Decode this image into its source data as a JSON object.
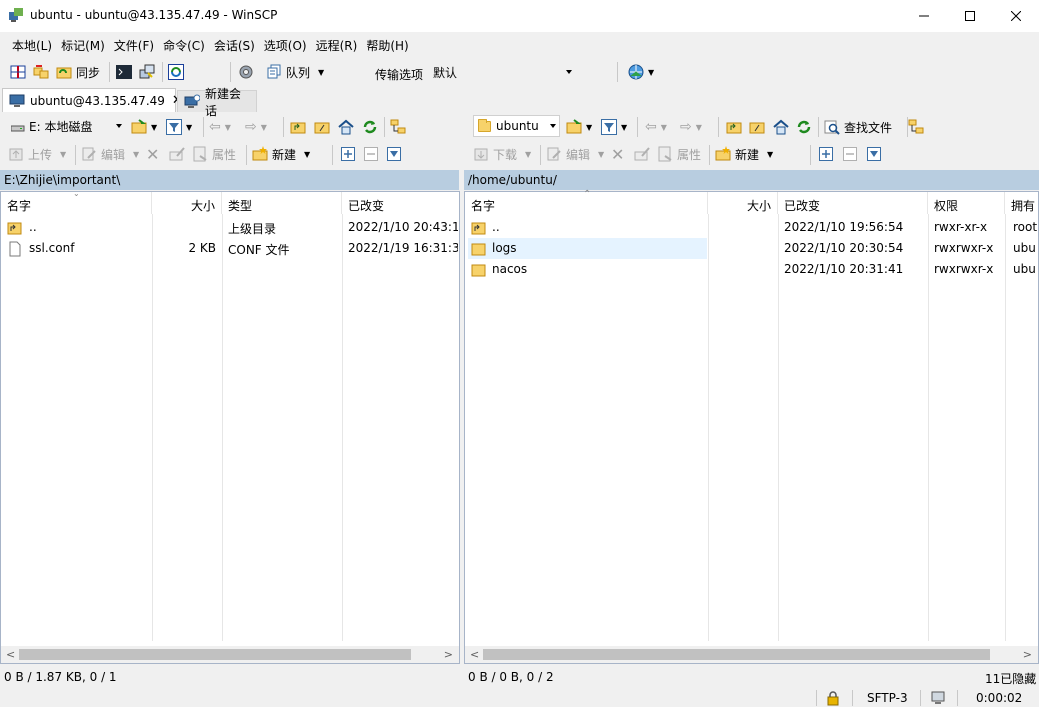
{
  "window": {
    "title": "ubuntu - ubuntu@43.135.47.49 - WinSCP"
  },
  "menu": [
    "本地(L)",
    "标记(M)",
    "文件(F)",
    "命令(C)",
    "会话(S)",
    "选项(O)",
    "远程(R)",
    "帮助(H)"
  ],
  "toolbar": {
    "sync_label": "同步",
    "queue_label": "队列",
    "transfer_label": "传输选项",
    "transfer_value": "默认"
  },
  "tabs": {
    "session": "ubuntu@43.135.47.49",
    "new_session": "新建会话"
  },
  "local": {
    "drive": "E: 本地磁盘",
    "upload": "上传",
    "edit": "编辑",
    "properties": "属性",
    "new": "新建",
    "path": "E:\\Zhijie\\important\\",
    "columns": {
      "name": "名字",
      "size": "大小",
      "type": "类型",
      "changed": "已改变"
    },
    "files": [
      {
        "name": "..",
        "size": "",
        "type": "上级目录",
        "changed": "2022/1/10  20:43:1"
      },
      {
        "name": "ssl.conf",
        "size": "2 KB",
        "type": "CONF 文件",
        "changed": "2022/1/19  16:31:3"
      }
    ],
    "status": "0 B / 1.87 KB,  0 / 1"
  },
  "remote": {
    "dir": "ubuntu",
    "find": "查找文件",
    "download": "下载",
    "edit": "编辑",
    "properties": "属性",
    "new": "新建",
    "path": "/home/ubuntu/",
    "columns": {
      "name": "名字",
      "size": "大小",
      "changed": "已改变",
      "rights": "权限",
      "owner": "拥有"
    },
    "files": [
      {
        "name": "..",
        "size": "",
        "changed": "2022/1/10 19:56:54",
        "rights": "rwxr-xr-x",
        "owner": "root"
      },
      {
        "name": "logs",
        "size": "",
        "changed": "2022/1/10 20:30:54",
        "rights": "rwxrwxr-x",
        "owner": "ubu"
      },
      {
        "name": "nacos",
        "size": "",
        "changed": "2022/1/10 20:31:41",
        "rights": "rwxrwxr-x",
        "owner": "ubu"
      }
    ],
    "status": "0 B / 0 B,  0 / 2",
    "hidden": "11已隐藏"
  },
  "statusbar": {
    "protocol": "SFTP-3",
    "time": "0:00:02"
  }
}
